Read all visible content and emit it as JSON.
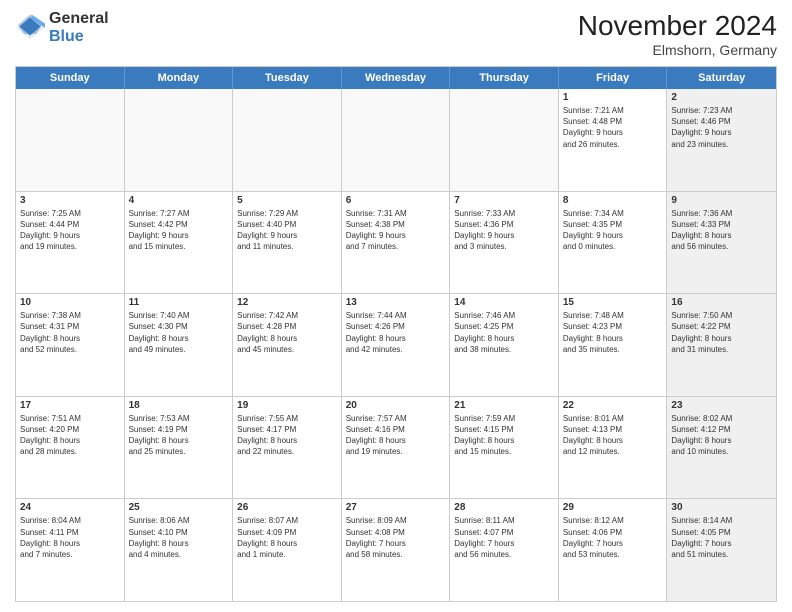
{
  "logo": {
    "general": "General",
    "blue": "Blue"
  },
  "header": {
    "month": "November 2024",
    "location": "Elmshorn, Germany"
  },
  "weekdays": [
    "Sunday",
    "Monday",
    "Tuesday",
    "Wednesday",
    "Thursday",
    "Friday",
    "Saturday"
  ],
  "rows": [
    [
      {
        "day": "",
        "info": "",
        "shaded": false,
        "empty": true
      },
      {
        "day": "",
        "info": "",
        "shaded": false,
        "empty": true
      },
      {
        "day": "",
        "info": "",
        "shaded": false,
        "empty": true
      },
      {
        "day": "",
        "info": "",
        "shaded": false,
        "empty": true
      },
      {
        "day": "",
        "info": "",
        "shaded": false,
        "empty": true
      },
      {
        "day": "1",
        "info": "Sunrise: 7:21 AM\nSunset: 4:48 PM\nDaylight: 9 hours\nand 26 minutes.",
        "shaded": false,
        "empty": false
      },
      {
        "day": "2",
        "info": "Sunrise: 7:23 AM\nSunset: 4:46 PM\nDaylight: 9 hours\nand 23 minutes.",
        "shaded": true,
        "empty": false
      }
    ],
    [
      {
        "day": "3",
        "info": "Sunrise: 7:25 AM\nSunset: 4:44 PM\nDaylight: 9 hours\nand 19 minutes.",
        "shaded": false,
        "empty": false
      },
      {
        "day": "4",
        "info": "Sunrise: 7:27 AM\nSunset: 4:42 PM\nDaylight: 9 hours\nand 15 minutes.",
        "shaded": false,
        "empty": false
      },
      {
        "day": "5",
        "info": "Sunrise: 7:29 AM\nSunset: 4:40 PM\nDaylight: 9 hours\nand 11 minutes.",
        "shaded": false,
        "empty": false
      },
      {
        "day": "6",
        "info": "Sunrise: 7:31 AM\nSunset: 4:38 PM\nDaylight: 9 hours\nand 7 minutes.",
        "shaded": false,
        "empty": false
      },
      {
        "day": "7",
        "info": "Sunrise: 7:33 AM\nSunset: 4:36 PM\nDaylight: 9 hours\nand 3 minutes.",
        "shaded": false,
        "empty": false
      },
      {
        "day": "8",
        "info": "Sunrise: 7:34 AM\nSunset: 4:35 PM\nDaylight: 9 hours\nand 0 minutes.",
        "shaded": false,
        "empty": false
      },
      {
        "day": "9",
        "info": "Sunrise: 7:36 AM\nSunset: 4:33 PM\nDaylight: 8 hours\nand 56 minutes.",
        "shaded": true,
        "empty": false
      }
    ],
    [
      {
        "day": "10",
        "info": "Sunrise: 7:38 AM\nSunset: 4:31 PM\nDaylight: 8 hours\nand 52 minutes.",
        "shaded": false,
        "empty": false
      },
      {
        "day": "11",
        "info": "Sunrise: 7:40 AM\nSunset: 4:30 PM\nDaylight: 8 hours\nand 49 minutes.",
        "shaded": false,
        "empty": false
      },
      {
        "day": "12",
        "info": "Sunrise: 7:42 AM\nSunset: 4:28 PM\nDaylight: 8 hours\nand 45 minutes.",
        "shaded": false,
        "empty": false
      },
      {
        "day": "13",
        "info": "Sunrise: 7:44 AM\nSunset: 4:26 PM\nDaylight: 8 hours\nand 42 minutes.",
        "shaded": false,
        "empty": false
      },
      {
        "day": "14",
        "info": "Sunrise: 7:46 AM\nSunset: 4:25 PM\nDaylight: 8 hours\nand 38 minutes.",
        "shaded": false,
        "empty": false
      },
      {
        "day": "15",
        "info": "Sunrise: 7:48 AM\nSunset: 4:23 PM\nDaylight: 8 hours\nand 35 minutes.",
        "shaded": false,
        "empty": false
      },
      {
        "day": "16",
        "info": "Sunrise: 7:50 AM\nSunset: 4:22 PM\nDaylight: 8 hours\nand 31 minutes.",
        "shaded": true,
        "empty": false
      }
    ],
    [
      {
        "day": "17",
        "info": "Sunrise: 7:51 AM\nSunset: 4:20 PM\nDaylight: 8 hours\nand 28 minutes.",
        "shaded": false,
        "empty": false
      },
      {
        "day": "18",
        "info": "Sunrise: 7:53 AM\nSunset: 4:19 PM\nDaylight: 8 hours\nand 25 minutes.",
        "shaded": false,
        "empty": false
      },
      {
        "day": "19",
        "info": "Sunrise: 7:55 AM\nSunset: 4:17 PM\nDaylight: 8 hours\nand 22 minutes.",
        "shaded": false,
        "empty": false
      },
      {
        "day": "20",
        "info": "Sunrise: 7:57 AM\nSunset: 4:16 PM\nDaylight: 8 hours\nand 19 minutes.",
        "shaded": false,
        "empty": false
      },
      {
        "day": "21",
        "info": "Sunrise: 7:59 AM\nSunset: 4:15 PM\nDaylight: 8 hours\nand 15 minutes.",
        "shaded": false,
        "empty": false
      },
      {
        "day": "22",
        "info": "Sunrise: 8:01 AM\nSunset: 4:13 PM\nDaylight: 8 hours\nand 12 minutes.",
        "shaded": false,
        "empty": false
      },
      {
        "day": "23",
        "info": "Sunrise: 8:02 AM\nSunset: 4:12 PM\nDaylight: 8 hours\nand 10 minutes.",
        "shaded": true,
        "empty": false
      }
    ],
    [
      {
        "day": "24",
        "info": "Sunrise: 8:04 AM\nSunset: 4:11 PM\nDaylight: 8 hours\nand 7 minutes.",
        "shaded": false,
        "empty": false
      },
      {
        "day": "25",
        "info": "Sunrise: 8:06 AM\nSunset: 4:10 PM\nDaylight: 8 hours\nand 4 minutes.",
        "shaded": false,
        "empty": false
      },
      {
        "day": "26",
        "info": "Sunrise: 8:07 AM\nSunset: 4:09 PM\nDaylight: 8 hours\nand 1 minute.",
        "shaded": false,
        "empty": false
      },
      {
        "day": "27",
        "info": "Sunrise: 8:09 AM\nSunset: 4:08 PM\nDaylight: 7 hours\nand 58 minutes.",
        "shaded": false,
        "empty": false
      },
      {
        "day": "28",
        "info": "Sunrise: 8:11 AM\nSunset: 4:07 PM\nDaylight: 7 hours\nand 56 minutes.",
        "shaded": false,
        "empty": false
      },
      {
        "day": "29",
        "info": "Sunrise: 8:12 AM\nSunset: 4:06 PM\nDaylight: 7 hours\nand 53 minutes.",
        "shaded": false,
        "empty": false
      },
      {
        "day": "30",
        "info": "Sunrise: 8:14 AM\nSunset: 4:05 PM\nDaylight: 7 hours\nand 51 minutes.",
        "shaded": true,
        "empty": false
      }
    ]
  ]
}
